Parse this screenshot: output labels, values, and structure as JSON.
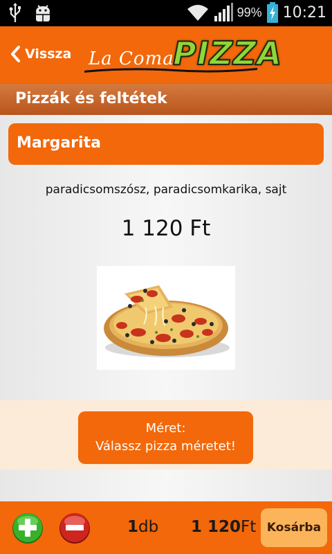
{
  "status_bar": {
    "icons": [
      "usb-icon",
      "android-debug-icon",
      "wifi-icon",
      "signal-icon",
      "battery-charging-icon"
    ],
    "battery_percent": "99%",
    "time": "10:21"
  },
  "header": {
    "back_label": "Vissza",
    "logo_script": "La Coma",
    "logo_word": "PIZZA",
    "colors": {
      "bar": "#f2680a",
      "logo_green": "#8fd63a"
    }
  },
  "section": {
    "title": "Pizzák és feltétek"
  },
  "product": {
    "name": "Margarita",
    "ingredients": "paradicsomszósz, paradicsomkarika, sajt",
    "price": "1 120 Ft"
  },
  "size": {
    "line1": "Méret:",
    "line2": "Válassz pizza méretet!"
  },
  "cart": {
    "qty_number": "1",
    "qty_unit": "db",
    "total_number": "1 120",
    "total_unit": "Ft",
    "button_label": "Kosárba"
  }
}
